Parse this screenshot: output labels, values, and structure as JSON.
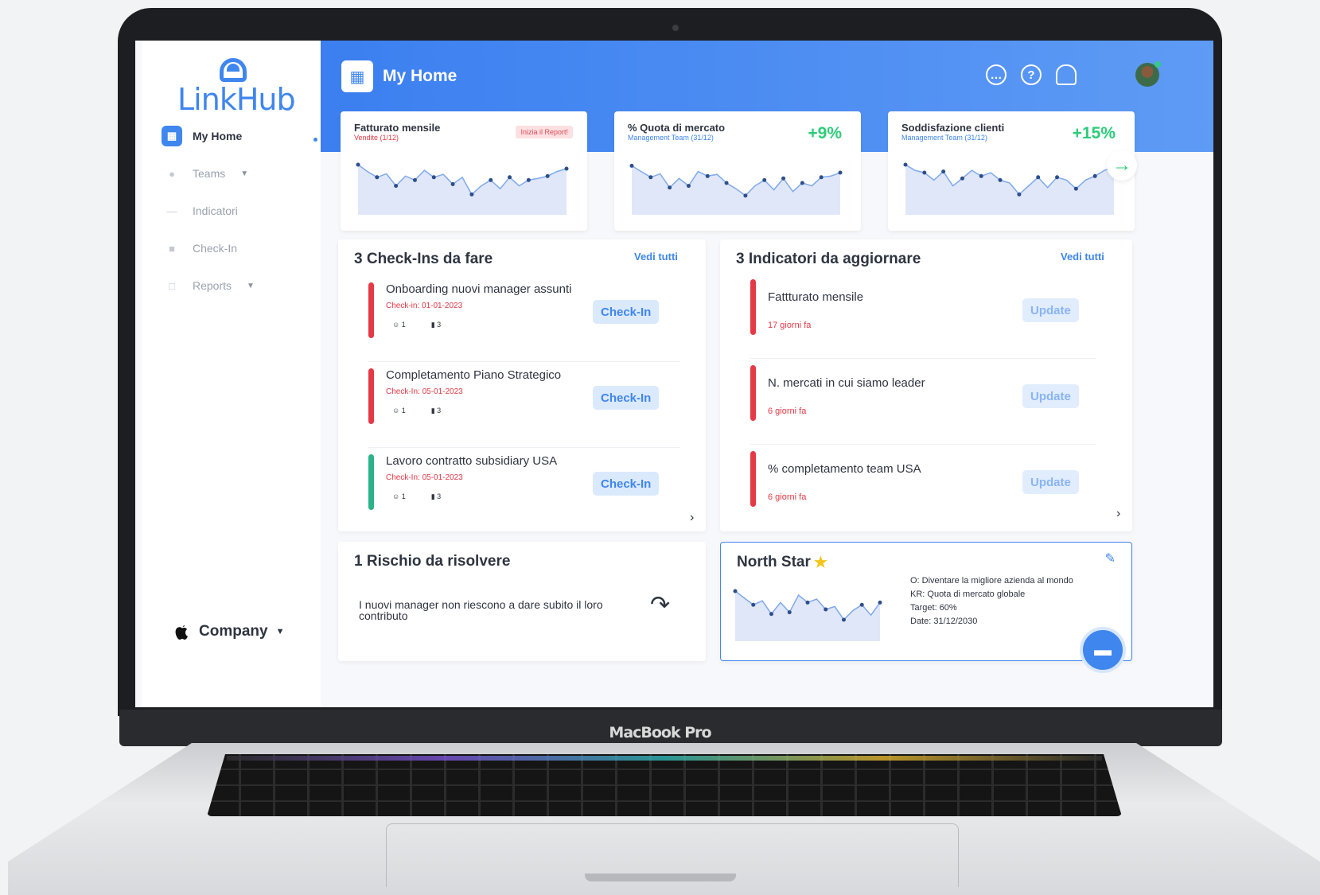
{
  "device": {
    "model_label": "MacBook Pro"
  },
  "brand": {
    "name": "LinkHub",
    "color": "#3f86ee"
  },
  "sidebar": {
    "items": [
      {
        "label": "My Home",
        "icon": "grid-icon",
        "active": true
      },
      {
        "label": "Teams",
        "icon": "users-icon",
        "has_caret": true
      },
      {
        "label": "Indicatori",
        "icon": "chart-icon"
      },
      {
        "label": "Check-In",
        "icon": "check-icon"
      },
      {
        "label": "Reports",
        "icon": "document-icon",
        "has_caret": true
      }
    ],
    "company": {
      "label": "Company",
      "icon": "apple-icon"
    }
  },
  "header": {
    "title": "My Home",
    "icons": [
      "chat-icon",
      "help-icon",
      "bell-icon",
      "avatar"
    ]
  },
  "kpis": [
    {
      "title": "Fatturato mensile",
      "subtitle": "Vendite (1/12)",
      "badge": "Inizia il Report!",
      "series": [
        82,
        70,
        60,
        66,
        45,
        62,
        55,
        72,
        60,
        65,
        48,
        60,
        30,
        45,
        55,
        40,
        60,
        45,
        55,
        58,
        62,
        70,
        75
      ]
    },
    {
      "title": "% Quota di mercato",
      "subtitle": "Management Team (31/12)",
      "value": "+9%",
      "series": [
        80,
        70,
        60,
        66,
        42,
        58,
        45,
        70,
        62,
        65,
        50,
        40,
        28,
        45,
        55,
        38,
        58,
        35,
        50,
        45,
        60,
        62,
        68
      ]
    },
    {
      "title": "Soddisfazione clienti",
      "subtitle": "Management Team (31/12)",
      "value": "+15%",
      "series": [
        82,
        72,
        68,
        55,
        70,
        45,
        58,
        72,
        62,
        68,
        55,
        50,
        30,
        45,
        60,
        42,
        60,
        55,
        40,
        55,
        62,
        72,
        78
      ]
    }
  ],
  "checkins": {
    "title": "3 Check-Ins da fare",
    "see_all": "Vedi tutti",
    "items": [
      {
        "title": "Onboarding nuovi manager assunti",
        "date": "Check-in: 01-01-2023",
        "people": "1",
        "comments": "3",
        "button": "Check-In",
        "status_color": "#e53945"
      },
      {
        "title": "Completamento Piano Strategico",
        "date": "Check-In: 05-01-2023",
        "people": "1",
        "comments": "3",
        "button": "Check-In",
        "status_color": "#e53945"
      },
      {
        "title": "Lavoro contratto subsidiary USA",
        "date": "Check-In: 05-01-2023",
        "people": "1",
        "comments": "3",
        "button": "Check-In",
        "status_color": "#2ab38a"
      }
    ]
  },
  "indicators": {
    "title": "3 Indicatori da aggiornare",
    "see_all": "Vedi tutti",
    "items": [
      {
        "title": "Fattturato mensile",
        "days": "17 giorni fa",
        "button": "Update"
      },
      {
        "title": "N. mercati in cui siamo leader",
        "days": "6 giorni fa",
        "button": "Update"
      },
      {
        "title": "% completamento team USA",
        "days": "6 giorni fa",
        "button": "Update"
      }
    ]
  },
  "risk": {
    "title": "1 Rischio da risolvere",
    "text": "I nuovi manager non riescono a dare subito il loro contributo"
  },
  "north_star": {
    "title": "North Star",
    "objective": "O: Diventare la migliore azienda al mondo",
    "key_result": "KR: Quota di mercato globale",
    "target": "Target: 60%",
    "date": "Date: 31/12/2030",
    "series": [
      82,
      70,
      58,
      65,
      42,
      62,
      45,
      75,
      62,
      68,
      50,
      55,
      32,
      48,
      58,
      40,
      62
    ]
  }
}
